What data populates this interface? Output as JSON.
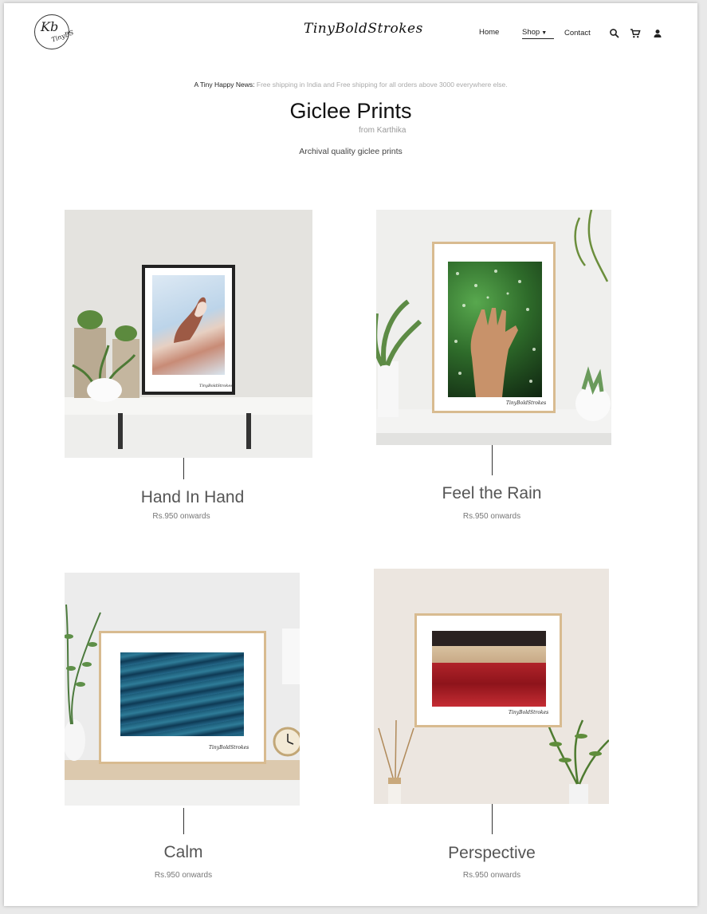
{
  "header": {
    "brand": "TinyBoldStrokes",
    "logo_text_1": "Kb",
    "logo_text_2": "TinyBS",
    "nav": {
      "home": "Home",
      "shop": "Shop",
      "contact": "Contact"
    },
    "icons": [
      "search-icon",
      "cart-icon",
      "user-icon"
    ]
  },
  "announcement": {
    "lead": "A Tiny Happy News:",
    "text": "Free shipping in India and Free shipping for all orders above 3000 everywhere else."
  },
  "collection": {
    "title": "Giclee Prints",
    "subtitle": "from Karthika",
    "description": "Archival quality giclee prints"
  },
  "products": [
    {
      "name": "Hand In Hand",
      "price": "Rs.950 onwards",
      "signature": "TinyBoldStrokes"
    },
    {
      "name": "Feel the Rain",
      "price": "Rs.950 onwards",
      "signature": "TinyBoldStrokes"
    },
    {
      "name": "Calm",
      "price": "Rs.950 onwards",
      "signature": "TinyBoldStrokes"
    },
    {
      "name": "Perspective",
      "price": "Rs.950 onwards",
      "signature": "TinyBoldStrokes"
    }
  ],
  "colors": {
    "text": "#222222",
    "muted": "#999999",
    "accent_frame": "#d8bb90"
  }
}
